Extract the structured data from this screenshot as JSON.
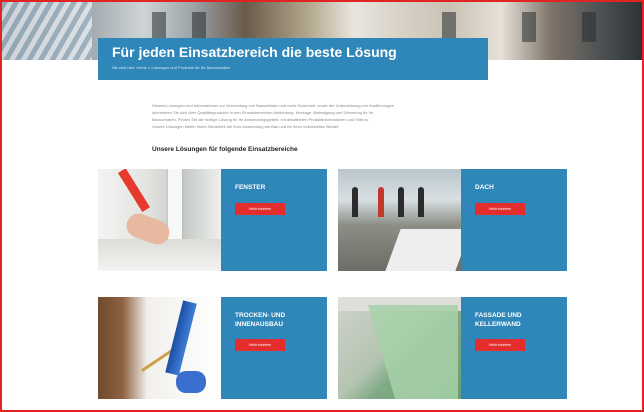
{
  "hero": {
    "title": "Für jeden Einsatzbereich die beste Lösung",
    "breadcrumb": "Sie sind hier: Home > Lösungen und Produkte für Ihr Bauvorhaben"
  },
  "intro": {
    "lines": [
      "Hinweis-Lösungen und Informationen zur Vermeidung von Bauschäden und mehr Sicherheit, sowie der Unterstützung von Ausführungen",
      "informieren Sie sich über Qualitätsprodukte in den Einsatzbereichen Abdichtung, Montage, Befestigung und Dämmung für Ihr",
      "Bauvorhaben. Finden Sie die richtige Lösung für Ihr Anwendungsgebiet, mit detaillierten Produktinformationen und Videos.",
      "Unsere Lösungen bieten Ihnen Sicherheit bei Ihrer Anwendung am Bau und für Ihren individuellen Bedarf."
    ]
  },
  "section": {
    "heading": "Unsere Lösungen für folgende Einsatzbereiche"
  },
  "cards": [
    {
      "label": "FENSTER",
      "button": "Mehr erfahren"
    },
    {
      "label": "DACH",
      "button": "Mehr erfahren"
    },
    {
      "label": "TROCKEN- UND INNENAUSBAU",
      "button": "Mehr erfahren"
    },
    {
      "label": "FASSADE UND KELLERWAND",
      "button": "Mehr erfahren"
    }
  ],
  "colors": {
    "accent_blue": "#2f86b8",
    "button_red": "#e52d2d",
    "frame_red": "#e02424"
  }
}
